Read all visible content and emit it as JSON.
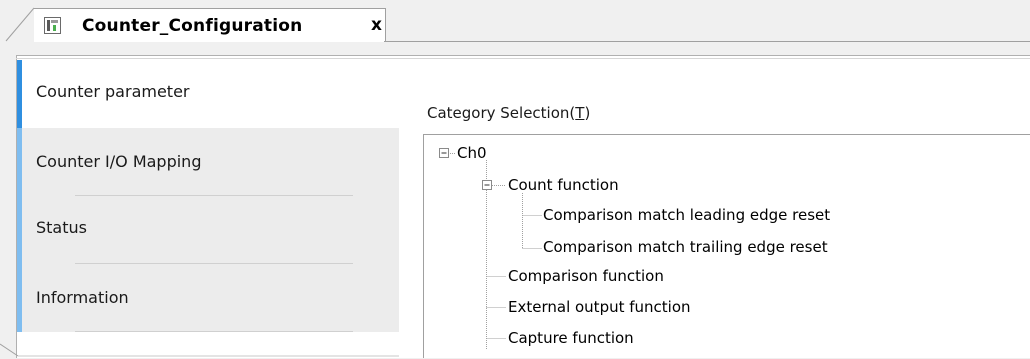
{
  "tab": {
    "title": "Counter_Configuration",
    "close_glyph": "x",
    "icon": "device-config-icon"
  },
  "side_tabs": [
    {
      "label": "Counter parameter",
      "active": true
    },
    {
      "label": "Counter I/O Mapping",
      "active": false
    },
    {
      "label": "Status",
      "active": false
    },
    {
      "label": "Information",
      "active": false
    }
  ],
  "category": {
    "label_prefix": "Category Selection(",
    "label_mnemonic": "T",
    "label_suffix": ")"
  },
  "tree": {
    "root": "Ch0",
    "count_function": "Count function",
    "leading_reset": "Comparison match leading edge reset",
    "trailing_reset": "Comparison match trailing edge reset",
    "comparison": "Comparison function",
    "external_output": "External output function",
    "capture": "Capture function"
  },
  "colors": {
    "accent_active": "#2f8fe0",
    "accent_inactive": "#7fbdf0"
  }
}
